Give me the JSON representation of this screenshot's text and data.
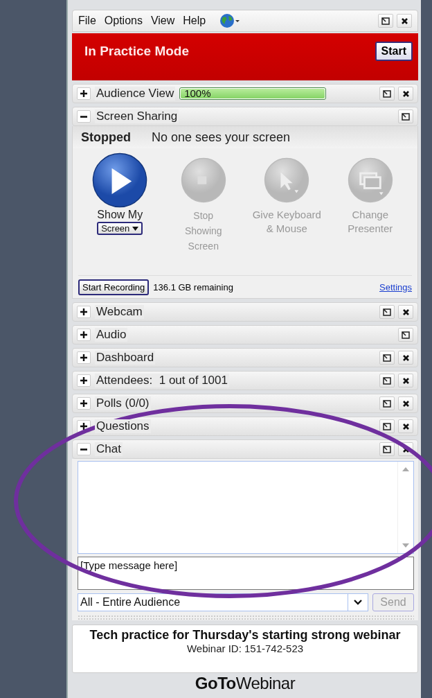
{
  "menu": {
    "items": [
      "File",
      "Options",
      "View",
      "Help"
    ]
  },
  "banner": {
    "title": "In Practice Mode",
    "button": "Start"
  },
  "sections": [
    {
      "title": "Audience View",
      "expanded": false,
      "closable": true,
      "kind": "meter",
      "level": 1,
      "reading": "100%"
    },
    {
      "title": "Screen Sharing",
      "expanded": true,
      "closable": false,
      "kind": "sharing",
      "status": "Stopped",
      "message": "No one sees your screen",
      "actions": [
        {
          "label": "Show My",
          "kind": "play",
          "enabled": true,
          "dropdown": "Screen"
        },
        {
          "label": "Stop Showing Screen",
          "kind": "stop",
          "enabled": false
        },
        {
          "label": "Give Keyboard & Mouse",
          "kind": "pointer",
          "enabled": false
        },
        {
          "label": "Change Presenter",
          "kind": "monitor",
          "enabled": false
        }
      ],
      "record_button": "Start Recording",
      "storage": "136.1 GB remaining",
      "settings_link": "Settings"
    },
    {
      "title": "Webcam",
      "expanded": false,
      "closable": true,
      "kind": "plain"
    },
    {
      "title": "Audio",
      "expanded": false,
      "closable": false,
      "kind": "plain"
    },
    {
      "title": "Dashboard",
      "expanded": false,
      "closable": true,
      "kind": "plain"
    },
    {
      "title": "Attendees:  1 out of 1001",
      "expanded": false,
      "closable": true,
      "kind": "plain"
    },
    {
      "title": "Polls (0/0)",
      "expanded": false,
      "closable": true,
      "kind": "plain"
    },
    {
      "title": "Questions",
      "expanded": false,
      "closable": true,
      "kind": "plain"
    },
    {
      "title": "Chat",
      "expanded": true,
      "closable": true,
      "kind": "chat",
      "placeholder": "[Type message here]",
      "recipient": "All - Entire Audience",
      "send": "Send",
      "send_disabled": true
    }
  ],
  "footer": {
    "title": "Tech practice for Thursday's starting strong webinar",
    "webinar_id": "Webinar ID: 151-742-523",
    "logo": "**GoTo**Webinar"
  }
}
